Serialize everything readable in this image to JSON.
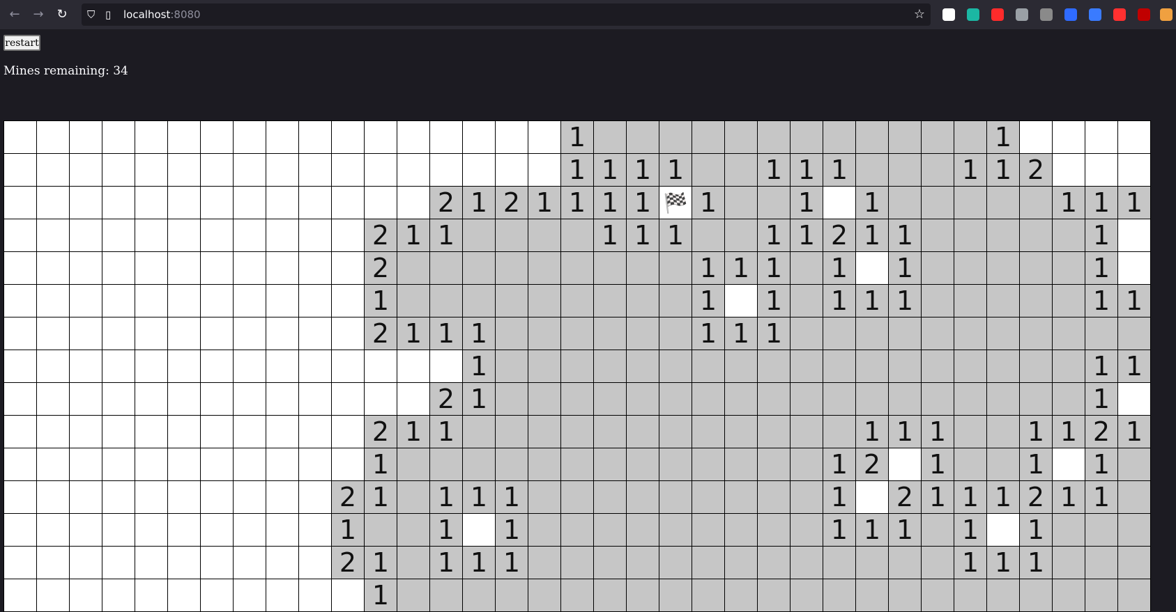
{
  "browser": {
    "url_host": "localhost",
    "url_port": ":8080",
    "icons": [
      "back-icon",
      "forward-icon",
      "reload-icon",
      "shield-icon",
      "page-icon",
      "star-icon"
    ],
    "extensions": [
      {
        "name": "ext-r-icon",
        "color": "#ffffff"
      },
      {
        "name": "ext-s-icon",
        "color": "#1bb7a3"
      },
      {
        "name": "ext-youtube-icon",
        "color": "#ff2b2b"
      },
      {
        "name": "ext-spy-icon",
        "color": "#9aa0a6"
      },
      {
        "name": "ext-k-icon",
        "color": "#8a8a8a"
      },
      {
        "name": "ext-lock-icon",
        "color": "#2f6bff"
      },
      {
        "name": "ext-translate-icon",
        "color": "#3a7bff"
      },
      {
        "name": "ext-pen-icon",
        "color": "#ff3030"
      },
      {
        "name": "ext-ublock-icon",
        "color": "#c00000"
      },
      {
        "name": "ext-gear-icon",
        "color": "#f0a040"
      }
    ]
  },
  "game": {
    "restart_label": "restart",
    "mines_label": "Mines remaining: 34",
    "flag_glyph": "🏁",
    "colors": {
      "revealed": "#c6c6c6",
      "hidden": "#ffffff",
      "grid": "#000000"
    },
    "board": [
      "....................1.......1......",
      "....................1111..111...112..",
      "...........21211FF1..1.1....111.",
      "...........211....111..11211....1.",
      "...........2..........111.1.1....1.",
      "...........1..........1.1.111....11",
      "...........2111.......111..........",
      ".............1....................11",
      "............21.....................1.",
      "...........211..............111..1121",
      "...........1...............12.1..1.1.",
      "..........21.111...........1.21112 1.",
      "..........1..1.1..........111.1.1...",
      "..........21.111.............111....",
      "...........1......................."
    ]
  }
}
